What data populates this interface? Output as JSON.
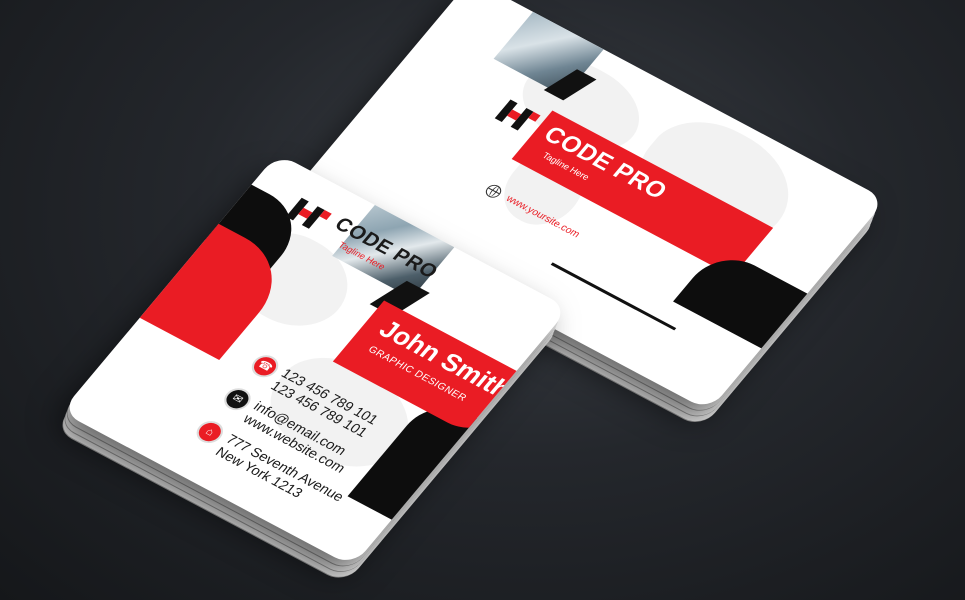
{
  "scene": {
    "background": "#24272c",
    "accent_red": "#ea1c24",
    "ink_black": "#0d0d0d"
  },
  "back_card": {
    "brand": "CODE PRO",
    "tagline": "Tagline Here",
    "website": "www.yoursite.com",
    "icons": [
      "logo-mark",
      "globe-icon"
    ]
  },
  "front_card": {
    "brand": "CODE PRO",
    "tagline": "Tagline Here",
    "name": "John Smith",
    "title": "GRAPHIC DESIGNER",
    "contacts": [
      {
        "icon": "phone-icon",
        "lines": [
          "123 456 789 101",
          "123 456 789 101"
        ]
      },
      {
        "icon": "mail-icon",
        "lines": [
          "info@email.com",
          "www.website.com"
        ]
      },
      {
        "icon": "location-icon",
        "lines": [
          "777 Seventh Avenue",
          "New York 1213"
        ]
      }
    ]
  }
}
